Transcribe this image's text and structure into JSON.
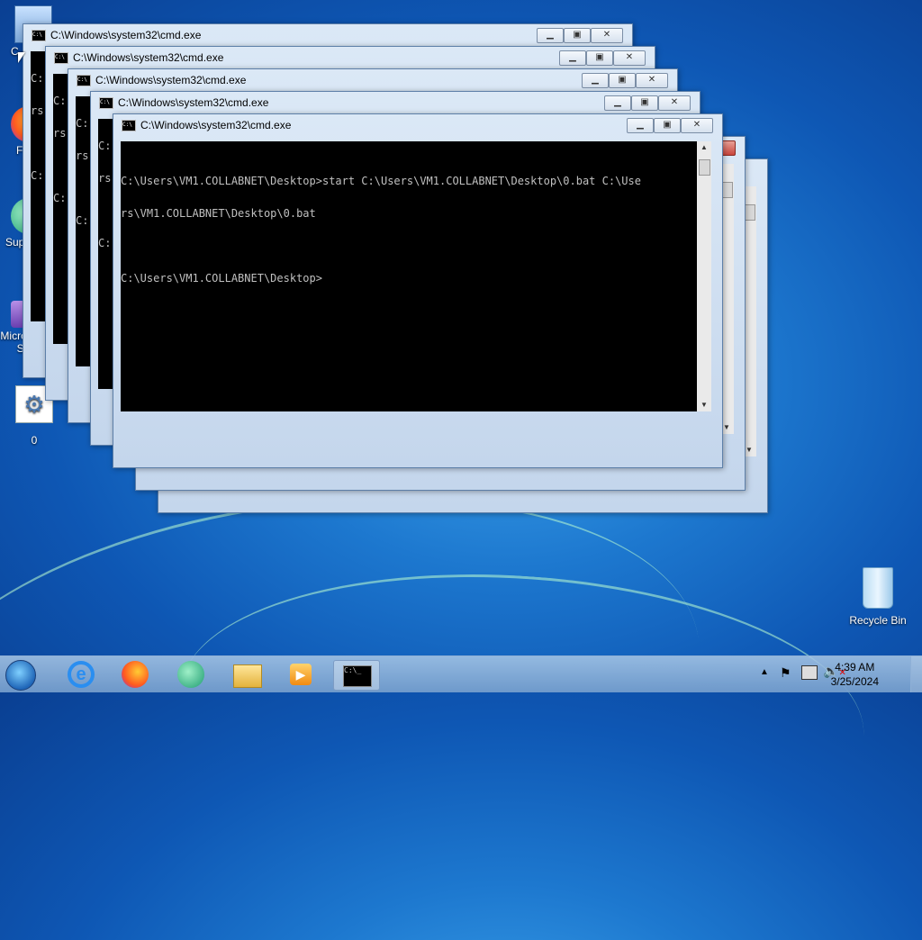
{
  "desktop": {
    "icons": [
      {
        "name": "computer",
        "label": "C"
      },
      {
        "name": "firefox",
        "label": "F"
      },
      {
        "name": "support",
        "label": "Sup"
      },
      {
        "name": "visual-studio",
        "label": "Micros Visual Stud..."
      },
      {
        "name": "batch-file",
        "label": "0"
      },
      {
        "name": "recycle-bin",
        "label": "Recycle Bin"
      }
    ]
  },
  "windows": [
    {
      "title": "C:\\Windows\\system32\\cmd.exe",
      "lines": [
        "C:",
        "rs",
        "",
        "C:"
      ]
    },
    {
      "title": "C:\\Windows\\system32\\cmd.exe",
      "lines": [
        "C:",
        "rs",
        "",
        "C:"
      ]
    },
    {
      "title": "C:\\Windows\\system32\\cmd.exe",
      "lines": [
        "C:",
        "rs",
        "",
        "C:"
      ]
    },
    {
      "title": "C:\\Windows\\system32\\cmd.exe",
      "lines": [
        "C:",
        "rs",
        "",
        "C:"
      ]
    },
    {
      "title": "C:\\Windows\\system32\\cmd.exe",
      "lines": [
        "C:\\Users\\VM1.COLLABNET\\Desktop>start C:\\Users\\VM1.COLLABNET\\Desktop\\0.bat C:\\Use",
        "rs\\VM1.COLLABNET\\Desktop\\0.bat",
        "",
        "C:\\Users\\VM1.COLLABNET\\Desktop>"
      ]
    }
  ],
  "taskbar": {
    "clock_time": "4:39 AM",
    "clock_date": "3/25/2024"
  },
  "colors": {
    "console_bg": "#000000",
    "console_fg": "#c0c0c0",
    "close_red": "#c9463d"
  }
}
